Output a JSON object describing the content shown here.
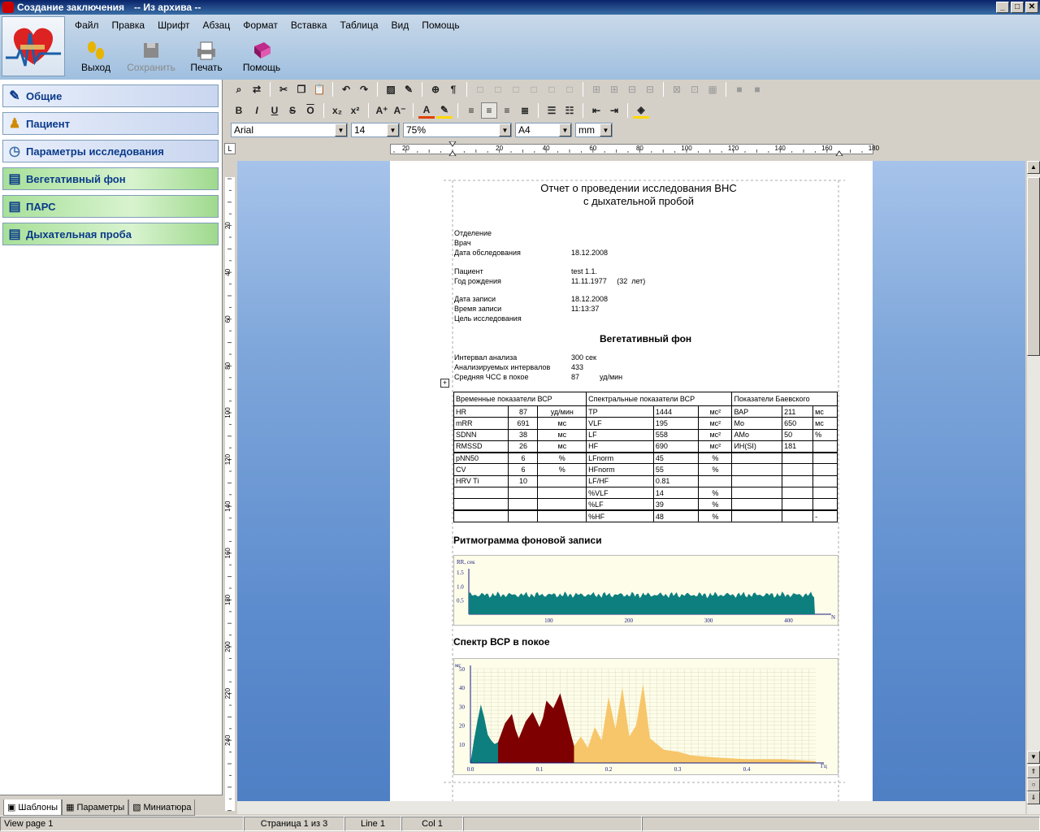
{
  "window": {
    "title": "Создание заключения",
    "subtitle": "-- Из архива --",
    "min": "_",
    "max": "□",
    "close": "✕"
  },
  "menu": [
    "Файл",
    "Правка",
    "Шрифт",
    "Абзац",
    "Формат",
    "Вставка",
    "Таблица",
    "Вид",
    "Помощь"
  ],
  "big_toolbar": {
    "exit": "Выход",
    "save": "Сохранить",
    "print": "Печать",
    "help": "Помощь"
  },
  "nav": {
    "general": "Общие",
    "patient": "Пациент",
    "params": "Параметры исследования",
    "veg": "Вегетативный фон",
    "pars": "ПАРС",
    "breath": "Дыхательная проба"
  },
  "bottom_tabs": {
    "templates": "Шаблоны",
    "params": "Параметры",
    "thumbs": "Миниатюра"
  },
  "format": {
    "font": "Arial",
    "size": "14",
    "zoom": "75%",
    "paper": "A4",
    "unit": "mm"
  },
  "ruler": {
    "h": [
      "20",
      "20",
      "40",
      "60",
      "80",
      "100",
      "120",
      "140",
      "160",
      "180"
    ],
    "v": [
      "20",
      "40",
      "60",
      "80",
      "100",
      "120",
      "140",
      "160",
      "180",
      "200",
      "220",
      "240"
    ]
  },
  "status": {
    "view": "View page 1",
    "page": "Страница 1 из 3",
    "line": "Line 1",
    "col": "Col 1"
  },
  "report": {
    "title1": "Отчет о проведении исследования ВНС",
    "title2": "с дыхательной пробой",
    "fields": [
      {
        "label": "Отделение",
        "value": ""
      },
      {
        "label": "Врач",
        "value": ""
      },
      {
        "label": "Дата обследования",
        "value": "18.12.2008"
      },
      {
        "label": "Пациент",
        "value": "test 1.1."
      },
      {
        "label": "Год рождения",
        "value": "11.11.1977     (32  лет)"
      },
      {
        "label": "Дата записи",
        "value": "18.12.2008"
      },
      {
        "label": "Время записи",
        "value": "11:13:37"
      },
      {
        "label": "Цель исследования",
        "value": ""
      }
    ],
    "section1": "Вегетативный фон",
    "bg_fields": [
      {
        "label": "Интервал анализа",
        "value": "300 сек"
      },
      {
        "label": "Анализируемых интервалов",
        "value": "433"
      },
      {
        "label": "Средняя ЧСС в покое",
        "value": "87          уд/мин"
      }
    ],
    "table_headers": [
      "Временные показатели ВСР",
      "Спектральные показатели ВСР",
      "Показатели Баевского"
    ],
    "table_rows": [
      [
        "HR",
        "87",
        "уд/мин",
        "TP",
        "1444",
        "мс²",
        "ВАР",
        "211",
        "мс"
      ],
      [
        "mRR",
        "691",
        "мс",
        "VLF",
        "195",
        "мс²",
        "Mo",
        "650",
        "мс"
      ],
      [
        "SDNN",
        "38",
        "мс",
        "LF",
        "558",
        "мс²",
        "AMo",
        "50",
        "%"
      ],
      [
        "RMSSD",
        "26",
        "мс",
        "HF",
        "690",
        "мс²",
        "ИН(SI)",
        "181",
        ""
      ],
      [
        "pNN50",
        "6",
        "%",
        "LFnorm",
        "45",
        "%",
        "",
        "",
        ""
      ],
      [
        "CV",
        "6",
        "%",
        "HFnorm",
        "55",
        "%",
        "",
        "",
        ""
      ],
      [
        "HRV Ti",
        "10",
        "",
        "LF/HF",
        "0.81",
        "",
        "",
        "",
        ""
      ],
      [
        "",
        "",
        "",
        "%VLF",
        "14",
        "%",
        "",
        "",
        ""
      ],
      [
        "",
        "",
        "",
        "%LF",
        "39",
        "%",
        "",
        "",
        ""
      ],
      [
        "",
        "",
        "",
        "%HF",
        "48",
        "%",
        "",
        "",
        "-"
      ]
    ],
    "rhythm_title": "Ритмограмма фоновой записи",
    "spectrum_title": "Спектр ВСР в покое"
  },
  "chart_data": [
    {
      "type": "area",
      "title": "Ритмограмма фоновой записи",
      "ylabel": "RR, сек",
      "xlabel": "N",
      "y_ticks": [
        "1.5",
        "1.0",
        "0.5"
      ],
      "x_ticks": [
        "100",
        "200",
        "300",
        "400"
      ],
      "xlim": [
        0,
        433
      ],
      "ylim": [
        0,
        1.5
      ],
      "series": [
        {
          "values_mean": 0.69
        }
      ],
      "colors": {
        "fill": "#0d7f7f"
      }
    },
    {
      "type": "area",
      "title": "Спектр ВСР в покое",
      "ylabel": "мс",
      "xlabel": "Гц",
      "y_ticks": [
        "50",
        "40",
        "30",
        "20",
        "10"
      ],
      "x_ticks": [
        "0.0",
        "0.1",
        "0.2",
        "0.3",
        "0.4"
      ],
      "xlim": [
        0,
        0.5
      ],
      "ylim": [
        0,
        50
      ],
      "series": [
        {
          "band": "VLF",
          "x": [
            0,
            0.005,
            0.01,
            0.015,
            0.02,
            0.025,
            0.03,
            0.035,
            0.04
          ],
          "y": [
            0,
            12,
            22,
            31,
            24,
            15,
            12,
            10,
            11
          ],
          "color": "#0d7f7f"
        },
        {
          "band": "LF",
          "x": [
            0.04,
            0.05,
            0.06,
            0.065,
            0.07,
            0.08,
            0.09,
            0.1,
            0.105,
            0.11,
            0.12,
            0.13,
            0.14,
            0.15
          ],
          "y": [
            11,
            21,
            26,
            18,
            13,
            22,
            27,
            19,
            24,
            33,
            29,
            37,
            23,
            9
          ],
          "color": "#7f0000"
        },
        {
          "band": "HF",
          "x": [
            0.15,
            0.16,
            0.17,
            0.18,
            0.19,
            0.2,
            0.21,
            0.22,
            0.23,
            0.24,
            0.25,
            0.26,
            0.28,
            0.3,
            0.32,
            0.35,
            0.4,
            0.45,
            0.5
          ],
          "y": [
            9,
            14,
            8,
            19,
            12,
            35,
            18,
            40,
            14,
            20,
            42,
            13,
            7,
            6,
            4,
            3,
            2,
            2,
            1
          ],
          "color": "#f7c66a"
        }
      ]
    }
  ],
  "colors": {
    "accent": "#0a246a",
    "nav_green": "#a8e09a",
    "doc_bg": "#5d8cce"
  }
}
